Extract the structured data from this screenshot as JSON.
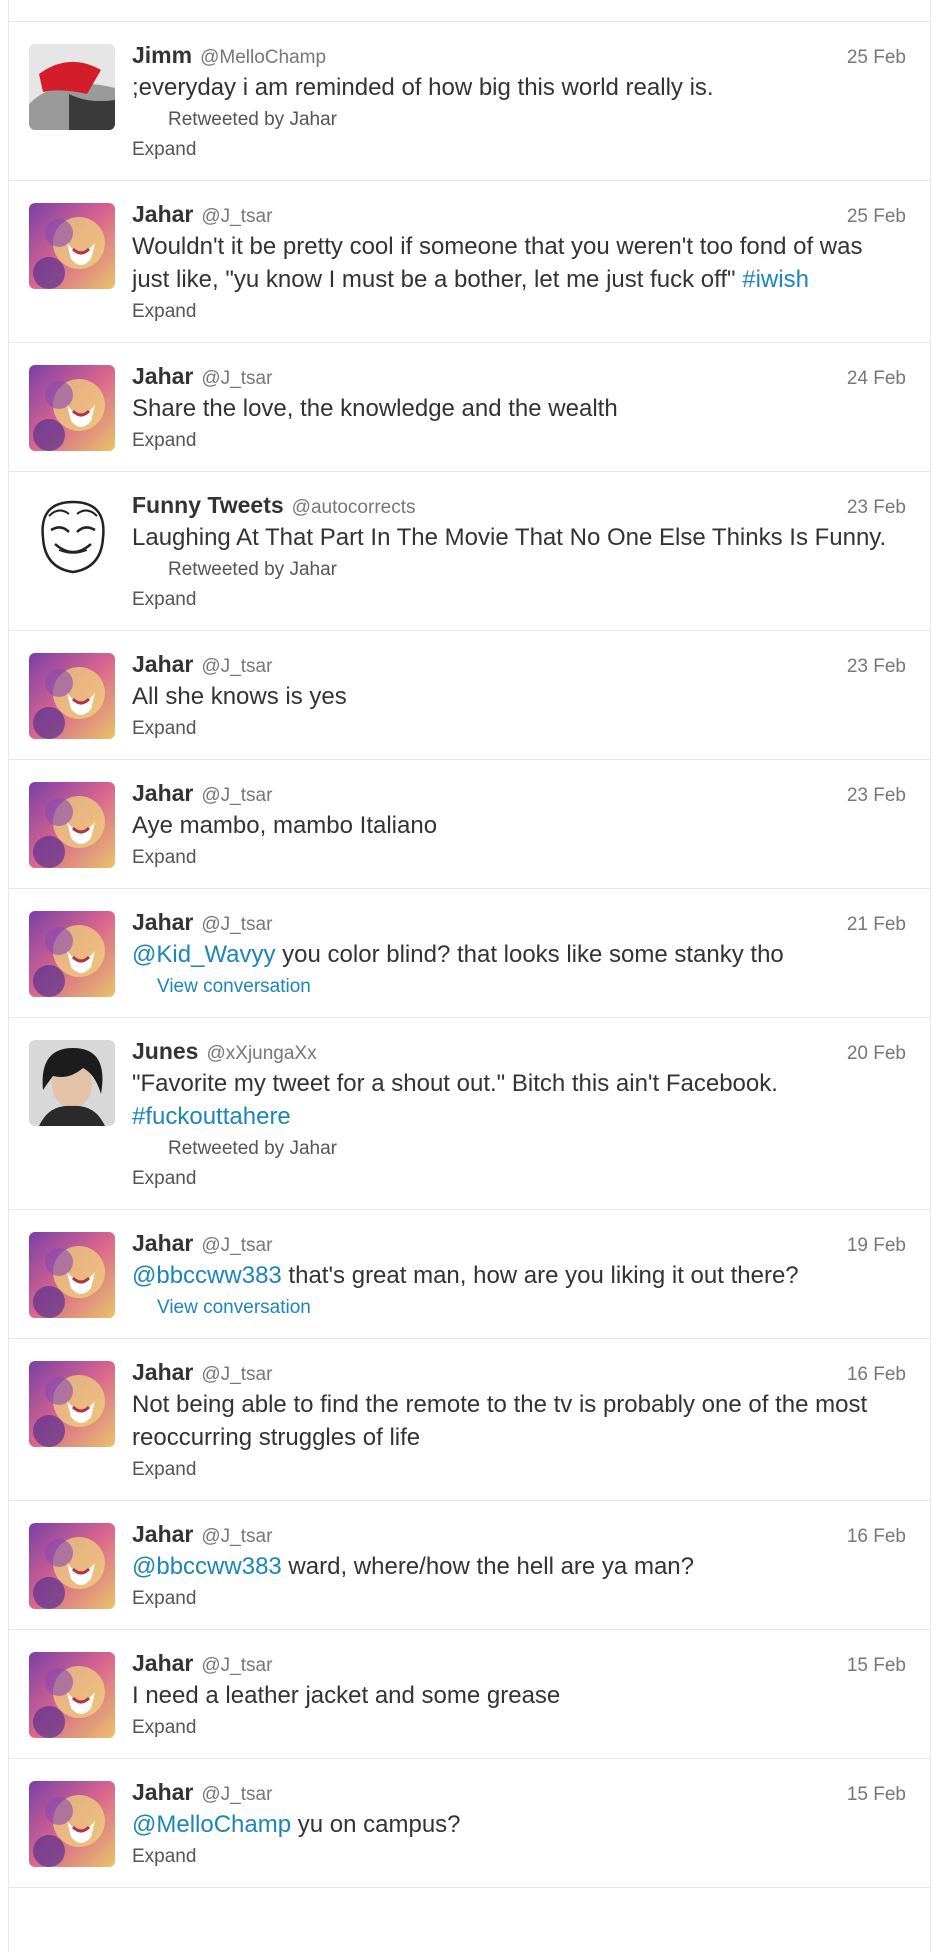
{
  "labels": {
    "expand": "Expand",
    "view_conversation": "View conversation",
    "retweeted_by": "Retweeted by Jahar"
  },
  "tweets": [
    {
      "name": "Jimm",
      "handle": "@MelloChamp",
      "time": "25 Feb",
      "avatar": "red-cap-avatar",
      "pre": "",
      "link": "",
      "post": ";everyday i am reminded of how big this world really is.",
      "tag": "",
      "retweet": true,
      "footer": "expand"
    },
    {
      "name": "Jahar",
      "handle": "@J_tsar",
      "time": "25 Feb",
      "avatar": "lion-avatar",
      "pre": "",
      "link": "",
      "post": "Wouldn't it be pretty cool if someone that you weren't too fond of was just like, \"yu know I must be a bother, let me just fuck off\" ",
      "tag": "#iwish",
      "retweet": false,
      "footer": "expand"
    },
    {
      "name": "Jahar",
      "handle": "@J_tsar",
      "time": "24 Feb",
      "avatar": "lion-avatar",
      "pre": "",
      "link": "",
      "post": "Share the love, the knowledge and the wealth",
      "tag": "",
      "retweet": false,
      "footer": "expand"
    },
    {
      "name": "Funny Tweets",
      "handle": "@autocorrects",
      "time": "23 Feb",
      "avatar": "rage-face-avatar",
      "pre": "",
      "link": "",
      "post": "Laughing At That Part In The Movie That No One Else Thinks Is Funny.",
      "tag": "",
      "retweet": true,
      "footer": "expand"
    },
    {
      "name": "Jahar",
      "handle": "@J_tsar",
      "time": "23 Feb",
      "avatar": "lion-avatar",
      "pre": "",
      "link": "",
      "post": "All she knows is yes",
      "tag": "",
      "retweet": false,
      "footer": "expand"
    },
    {
      "name": "Jahar",
      "handle": "@J_tsar",
      "time": "23 Feb",
      "avatar": "lion-avatar",
      "pre": "",
      "link": "",
      "post": "Aye mambo, mambo Italiano",
      "tag": "",
      "retweet": false,
      "footer": "expand"
    },
    {
      "name": "Jahar",
      "handle": "@J_tsar",
      "time": "21 Feb",
      "avatar": "lion-avatar",
      "pre": "",
      "link": "@Kid_Wavyy",
      "post": " you color blind? that looks like some stanky tho",
      "tag": "",
      "retweet": false,
      "footer": "conversation"
    },
    {
      "name": "Junes",
      "handle": "@xXjungaXx",
      "time": "20 Feb",
      "avatar": "dark-hair-avatar",
      "pre": "",
      "link": "",
      "post": "\"Favorite my tweet for a shout out.\" Bitch this ain't Facebook. ",
      "tag": "#fuckouttahere",
      "retweet": true,
      "footer": "expand"
    },
    {
      "name": "Jahar",
      "handle": "@J_tsar",
      "time": "19 Feb",
      "avatar": "lion-avatar",
      "pre": "",
      "link": "@bbccww383",
      "post": " that's great man, how are you liking it out there?",
      "tag": "",
      "retweet": false,
      "footer": "conversation"
    },
    {
      "name": "Jahar",
      "handle": "@J_tsar",
      "time": "16 Feb",
      "avatar": "lion-avatar",
      "pre": "",
      "link": "",
      "post": "Not being able to find the remote to the tv is probably one of the most reoccurring struggles of life",
      "tag": "",
      "retweet": false,
      "footer": "expand"
    },
    {
      "name": "Jahar",
      "handle": "@J_tsar",
      "time": "16 Feb",
      "avatar": "lion-avatar",
      "pre": "",
      "link": "@bbccww383",
      "post": " ward, where/how the hell are ya man?",
      "tag": "",
      "retweet": false,
      "footer": "expand"
    },
    {
      "name": "Jahar",
      "handle": "@J_tsar",
      "time": "15 Feb",
      "avatar": "lion-avatar",
      "pre": "",
      "link": "",
      "post": "I need a leather jacket and some grease",
      "tag": "",
      "retweet": false,
      "footer": "expand"
    },
    {
      "name": "Jahar",
      "handle": "@J_tsar",
      "time": "15 Feb",
      "avatar": "lion-avatar",
      "pre": "",
      "link": "@MelloChamp",
      "post": " yu on campus?",
      "tag": "",
      "retweet": false,
      "footer": "expand"
    }
  ]
}
